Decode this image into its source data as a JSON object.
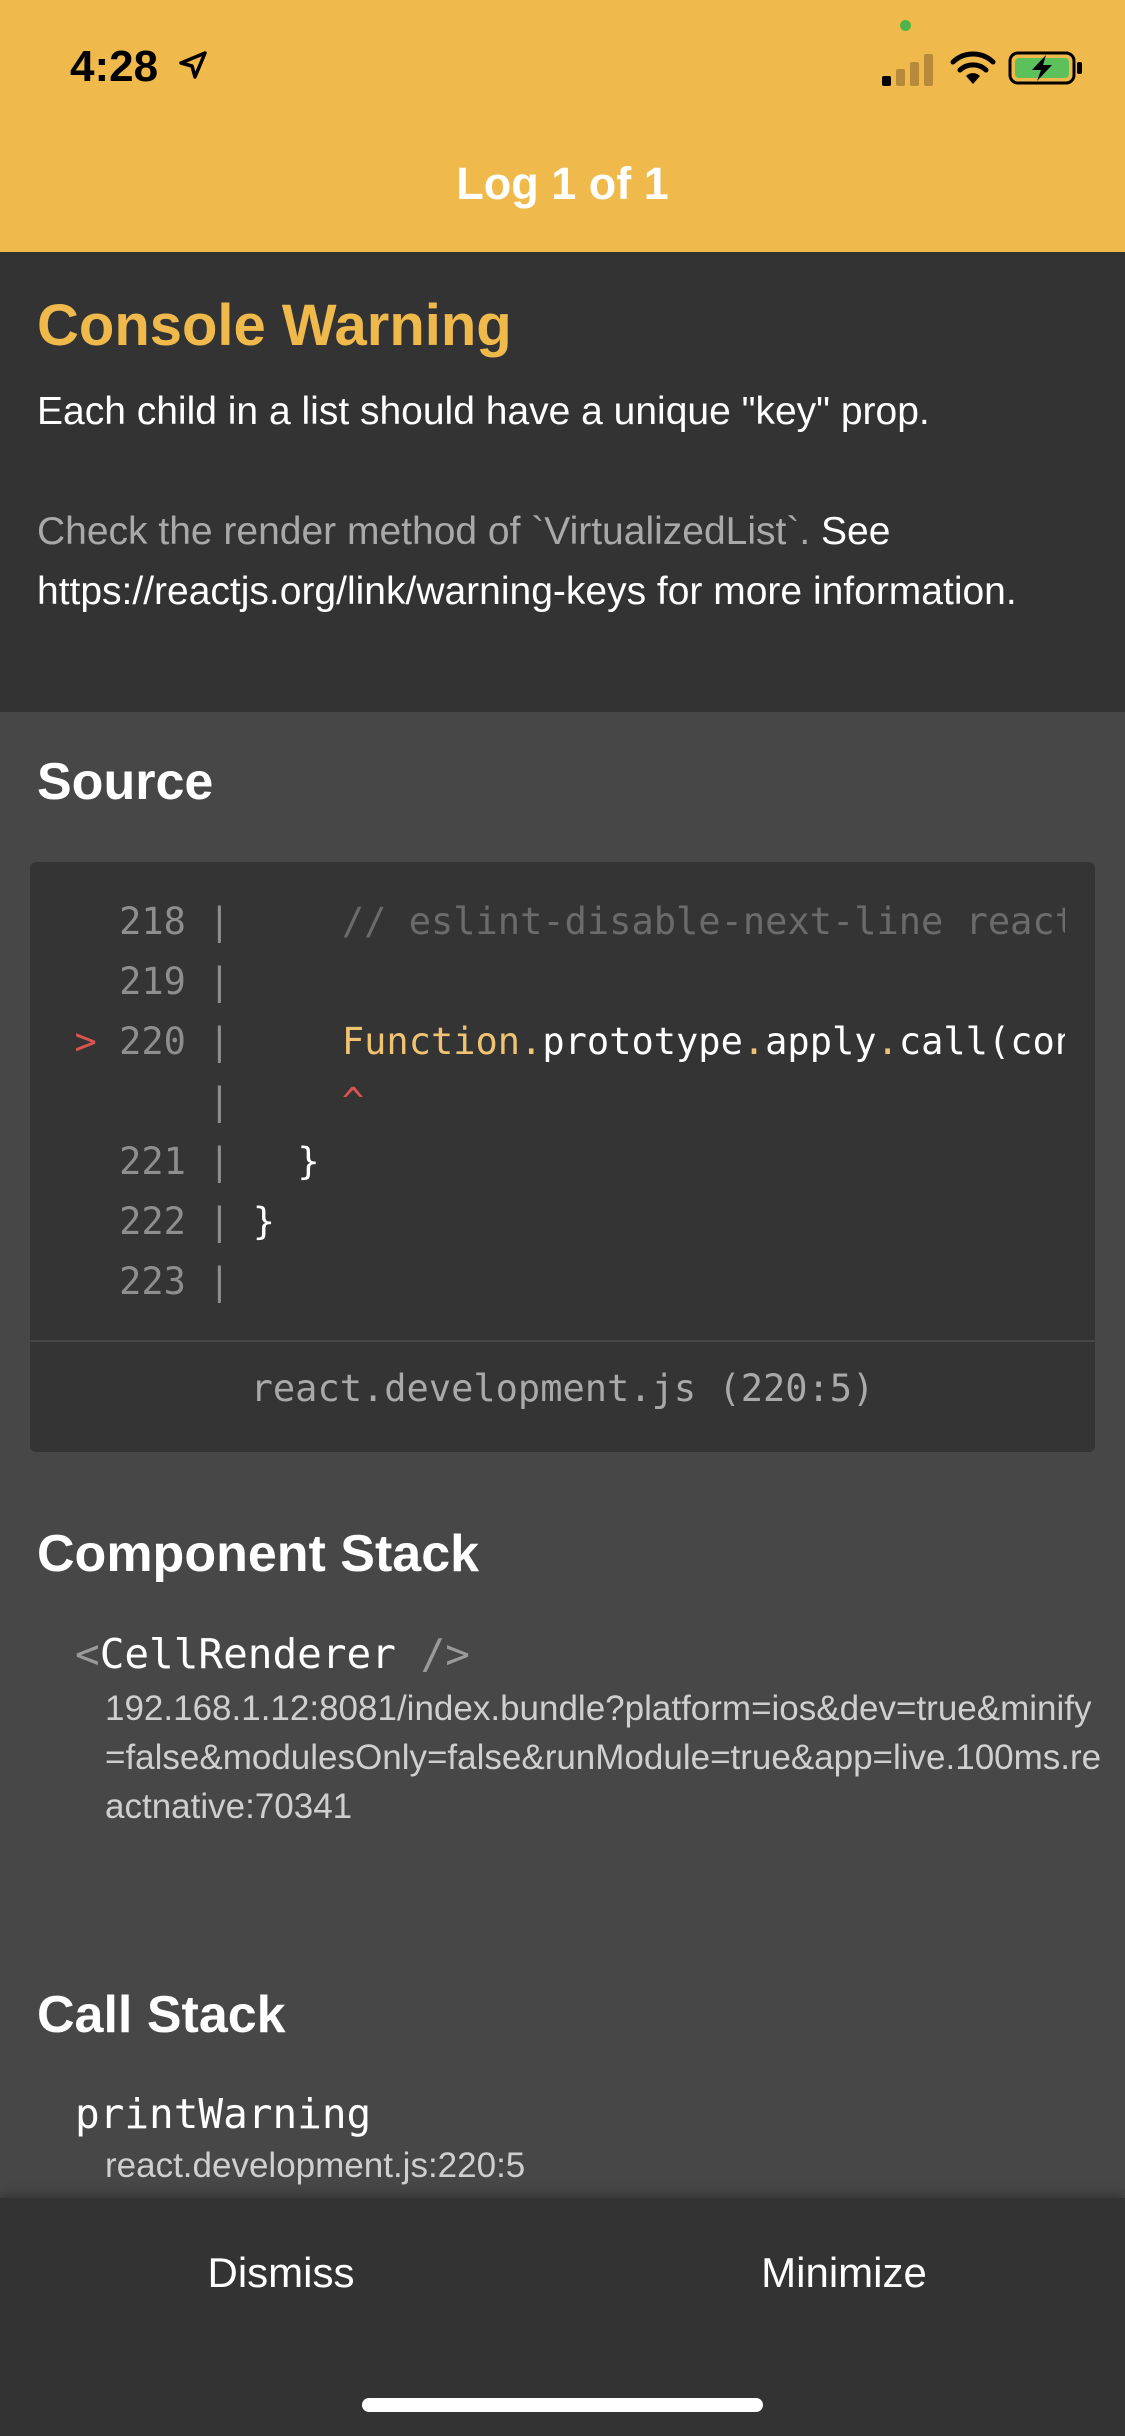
{
  "status_bar": {
    "time": "4:28",
    "location_icon": "location-arrow-icon",
    "signal_icon": "cellular-signal-icon",
    "wifi_icon": "wifi-icon",
    "battery_icon": "battery-charging-icon"
  },
  "header": {
    "title": "Log 1 of 1",
    "background_color": "#f0b94c"
  },
  "warning": {
    "type": "Console Warning",
    "message": "Each child in a list should have a unique \"key\" prop.",
    "detail_muted": "Check the render method of `VirtualizedList`.",
    "detail_rest": " See https://reactjs.org/link/warning-keys for more information."
  },
  "source": {
    "title": "Source",
    "lines": [
      {
        "marker": "  ",
        "number": "218",
        "sep": " | ",
        "segments": [
          {
            "t": "    ",
            "c": "txt"
          },
          {
            "t": "// eslint-disable-next-line react-internal/no-production-logging",
            "c": "cm"
          }
        ]
      },
      {
        "marker": "  ",
        "number": "219",
        "sep": " | ",
        "segments": []
      },
      {
        "marker": "> ",
        "number": "220",
        "sep": " | ",
        "segments": [
          {
            "t": "    ",
            "c": "txt"
          },
          {
            "t": "Function",
            "c": "fn"
          },
          {
            "t": ".",
            "c": "fn"
          },
          {
            "t": "prototype",
            "c": "txt"
          },
          {
            "t": ".",
            "c": "fn"
          },
          {
            "t": "apply",
            "c": "txt"
          },
          {
            "t": ".",
            "c": "fn"
          },
          {
            "t": "call(console[level], console, argsWithFormat);",
            "c": "txt"
          }
        ]
      },
      {
        "marker": "  ",
        "number": "   ",
        "sep": " | ",
        "segments": [
          {
            "t": "    ",
            "c": "txt"
          },
          {
            "t": "^",
            "c": "caret"
          }
        ]
      },
      {
        "marker": "  ",
        "number": "221",
        "sep": " | ",
        "segments": [
          {
            "t": "  }",
            "c": "txt"
          }
        ]
      },
      {
        "marker": "  ",
        "number": "222",
        "sep": " | ",
        "segments": [
          {
            "t": "}",
            "c": "txt"
          }
        ]
      },
      {
        "marker": "  ",
        "number": "223",
        "sep": " | ",
        "segments": []
      }
    ],
    "file": "react.development.js (220:5)"
  },
  "component_stack": {
    "title": "Component Stack",
    "frames": [
      {
        "open": "<",
        "name": "CellRenderer",
        "close": " />",
        "location": "192.168.1.12:8081/index.bundle?platform=ios&dev=true&minify=false&modulesOnly=false&runModule=true&app=live.100ms.reactnative:70341"
      }
    ]
  },
  "call_stack": {
    "title": "Call Stack",
    "frames": [
      {
        "name": "printWarning",
        "location": "react.development.js:220:5"
      }
    ]
  },
  "footer": {
    "dismiss_label": "Dismiss",
    "minimize_label": "Minimize"
  }
}
